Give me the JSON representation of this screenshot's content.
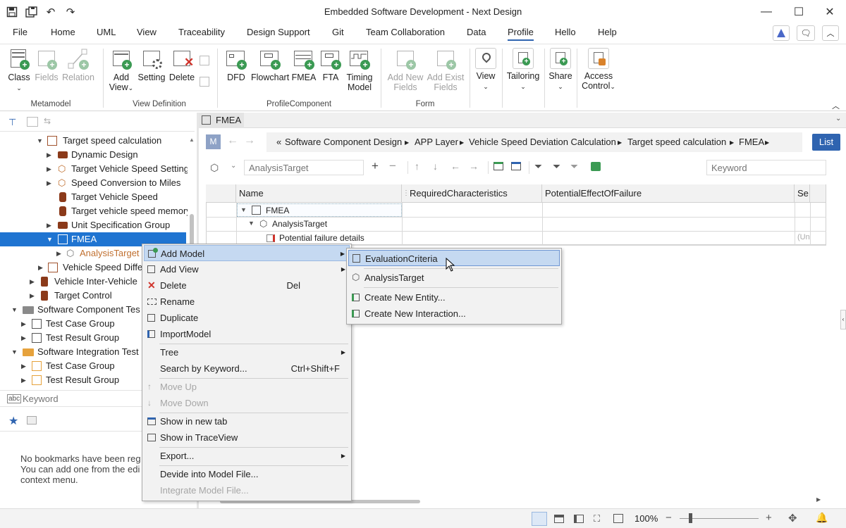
{
  "window": {
    "title": "Embedded Software Development - Next Design"
  },
  "menu": {
    "items": [
      "File",
      "Home",
      "UML",
      "View",
      "Traceability",
      "Design Support",
      "Git",
      "Team Collaboration",
      "Data",
      "Profile",
      "Hello",
      "Help"
    ],
    "selected": "Profile"
  },
  "ribbon": {
    "metamodel": {
      "group": "Metamodel",
      "class": "Class",
      "fields": "Fields",
      "relation": "Relation"
    },
    "view_definition": {
      "group": "View Definition",
      "add_view_1": "Add",
      "add_view_2": "View",
      "setting": "Setting",
      "delete": "Delete"
    },
    "profile_component": {
      "group": "ProfileComponent",
      "dfd": "DFD",
      "flowchart": "Flowchart",
      "fmea": "FMEA",
      "fta": "FTA",
      "timing_1": "Timing",
      "timing_2": "Model"
    },
    "form": {
      "group": "Form",
      "add_new_1": "Add New",
      "add_new_2": "Fields",
      "add_exist_1": "Add Exist",
      "add_exist_2": "Fields"
    },
    "other": {
      "view": "View",
      "tailoring": "Tailoring",
      "share": "Share",
      "access_1": "Access",
      "access_2": "Control"
    }
  },
  "tree": {
    "items": [
      {
        "label": "Target speed calculation"
      },
      {
        "label": "Dynamic Design"
      },
      {
        "label": "Target Vehicle Speed Setting"
      },
      {
        "label": "Speed Conversion to Miles"
      },
      {
        "label": "Target Vehicle Speed"
      },
      {
        "label": "Target vehicle speed memory"
      },
      {
        "label": "Unit Specification Group"
      },
      {
        "label": "FMEA"
      },
      {
        "label": "AnalysisTarget"
      },
      {
        "label": "Vehicle Speed Differ"
      },
      {
        "label": "Vehicle Inter-Vehicle"
      },
      {
        "label": "Target Control"
      },
      {
        "label": "Software Component Tes"
      },
      {
        "label": "Test Case Group"
      },
      {
        "label": "Test Result Group"
      },
      {
        "label": "Software Integration Test"
      },
      {
        "label": "Test Case Group"
      },
      {
        "label": "Test Result Group"
      }
    ],
    "keyword_placeholder": "Keyword"
  },
  "bookmarks": {
    "empty_lines": [
      "No bookmarks have been reg",
      "You can add one from the edi",
      "context menu."
    ]
  },
  "editor": {
    "tab": "FMEA",
    "mode_badge": "M",
    "breadcrumb": [
      "«",
      "Software Component Design",
      "APP Layer",
      "Vehicle Speed Deviation Calculation",
      "Target speed calculation",
      "FMEA"
    ],
    "list_button": "List",
    "target_placeholder": "AnalysisTarget",
    "keyword_placeholder": "Keyword",
    "columns": [
      "Name",
      "RequiredCharacteristics",
      "PotentialEffectOfFailure",
      "Se"
    ],
    "rows": [
      {
        "name": "FMEA"
      },
      {
        "name": "AnalysisTarget"
      },
      {
        "name": "Potential failure details",
        "extra": "(Un"
      }
    ]
  },
  "context_menu": {
    "items": [
      {
        "label": "Add Model",
        "submenu": true
      },
      {
        "label": "Add View",
        "submenu": true
      },
      {
        "label": "Delete",
        "shortcut": "Del"
      },
      {
        "label": "Rename"
      },
      {
        "label": "Duplicate"
      },
      {
        "label": "ImportModel"
      },
      {
        "label": "Tree",
        "submenu": true
      },
      {
        "label": "Search by Keyword...",
        "shortcut": "Ctrl+Shift+F"
      },
      {
        "label": "Move Up",
        "disabled": true
      },
      {
        "label": "Move Down",
        "disabled": true
      },
      {
        "label": "Show in new tab"
      },
      {
        "label": "Show in TraceView"
      },
      {
        "label": "Export...",
        "submenu": true
      },
      {
        "label": "Devide into Model File..."
      },
      {
        "label": "Integrate Model File...",
        "disabled": true
      }
    ]
  },
  "submenu": {
    "items": [
      {
        "label": "EvaluationCriteria"
      },
      {
        "label": "AnalysisTarget"
      },
      {
        "label": "Create New Entity..."
      },
      {
        "label": "Create New Interaction..."
      }
    ]
  },
  "statusbar": {
    "zoom": "100%"
  },
  "colors": {
    "accent": "#2f64b0",
    "selection": "#1f74d1",
    "menu_highlight": "#c5d9f1",
    "green": "#3b9a53"
  }
}
